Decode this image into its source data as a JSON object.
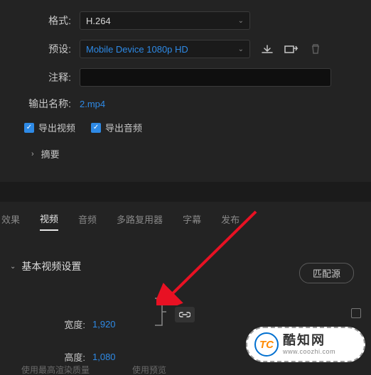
{
  "format": {
    "label": "格式:",
    "value": "H.264"
  },
  "preset": {
    "label": "预设:",
    "value": "Mobile Device 1080p HD"
  },
  "comment": {
    "label": "注释:",
    "value": ""
  },
  "outputName": {
    "label": "输出名称:",
    "value": "2.mp4"
  },
  "exportVideo": {
    "label": "导出视频",
    "checked": true
  },
  "exportAudio": {
    "label": "导出音频",
    "checked": true
  },
  "summary": {
    "label": "摘要"
  },
  "tabs": {
    "effects": "效果",
    "video": "视频",
    "audio": "音频",
    "multi": "多路复用器",
    "subtitle": "字幕",
    "publish": "发布"
  },
  "section": {
    "title": "基本视频设置"
  },
  "matchSource": "匹配源",
  "width": {
    "label": "宽度:",
    "value": "1,920"
  },
  "height": {
    "label": "高度:",
    "value": "1,080"
  },
  "bottom": {
    "a": "使用最高渲染质量",
    "b": "使用预览"
  },
  "watermark": {
    "logo": "TC",
    "cn": "酷知网",
    "url": "www.coozhi.com"
  }
}
